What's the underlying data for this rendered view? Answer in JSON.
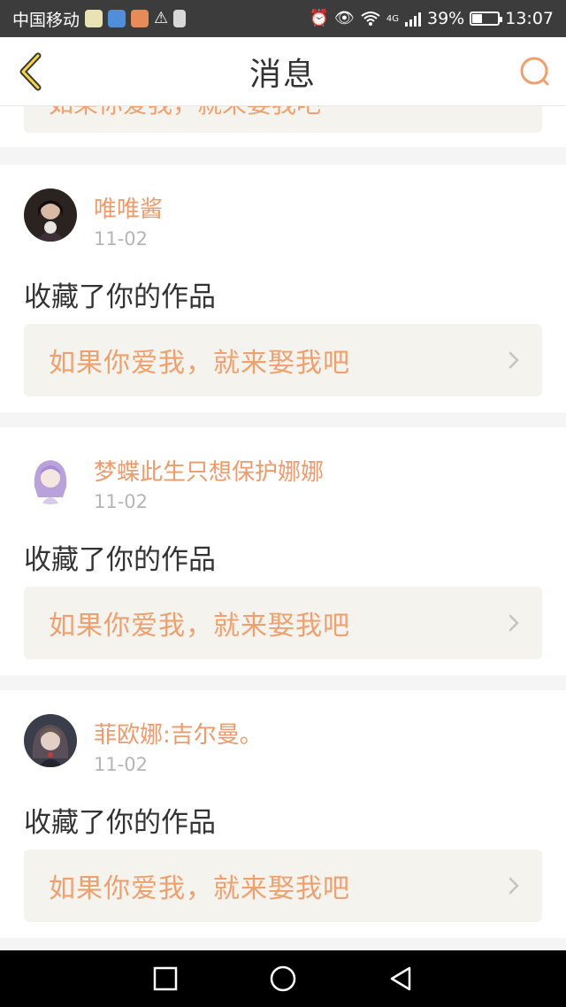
{
  "status_bar": {
    "carrier": "中国移动",
    "signal_label": "4G",
    "battery": "39%",
    "battery_level": 0.39,
    "time": "13:07",
    "icons": [
      "alarm-icon",
      "eye-icon",
      "wifi-icon",
      "signal-icon",
      "battery-icon"
    ]
  },
  "header": {
    "title": "消息",
    "back_icon": "chevron-left-icon",
    "search_icon": "search-icon",
    "accent_color": "#f0a06e"
  },
  "stub": {
    "work_title": "如果你爱我，就来娶我吧"
  },
  "messages": [
    {
      "user": "唯唯酱",
      "date": "11-02",
      "action": "收藏了你的作品",
      "work_title": "如果你爱我，就来娶我吧"
    },
    {
      "user": "梦蝶此生只想保护娜娜",
      "date": "11-02",
      "action": "收藏了你的作品",
      "work_title": "如果你爱我，就来娶我吧"
    },
    {
      "user": "菲欧娜:吉尔曼。",
      "date": "11-02",
      "action": "收藏了你的作品",
      "work_title": "如果你爱我，就来娶我吧"
    }
  ],
  "nav": {
    "buttons": [
      "recents-button",
      "home-button",
      "back-button"
    ]
  }
}
